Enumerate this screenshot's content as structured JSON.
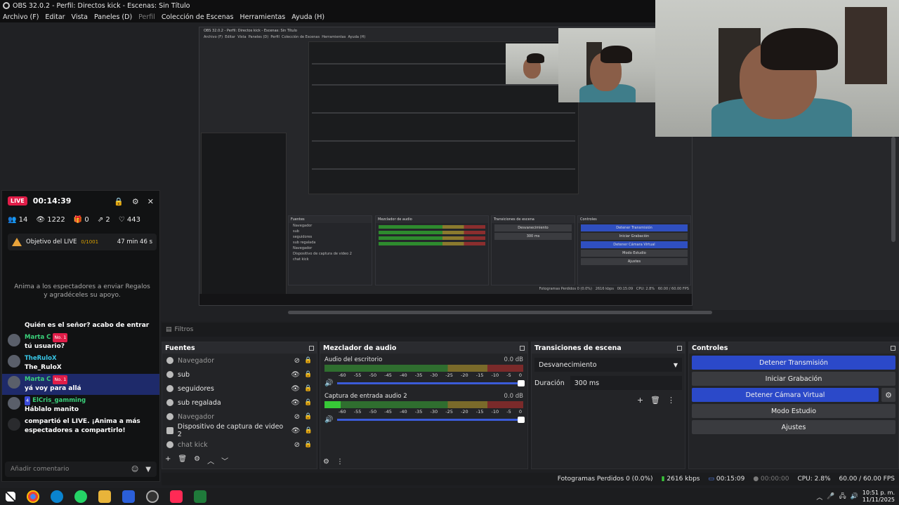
{
  "window": {
    "title": "OBS 32.0.2 - Perfil: Directos kick - Escenas: Sin Título"
  },
  "menu": [
    {
      "label": "Archivo (F)",
      "enabled": true
    },
    {
      "label": "Editar",
      "enabled": true
    },
    {
      "label": "Vista",
      "enabled": true
    },
    {
      "label": "Paneles (D)",
      "enabled": true
    },
    {
      "label": "Perfil",
      "enabled": false
    },
    {
      "label": "Colección de Escenas",
      "enabled": true
    },
    {
      "label": "Herramientas",
      "enabled": true
    },
    {
      "label": "Ayuda (H)",
      "enabled": true
    }
  ],
  "live_widget": {
    "badge": "LIVE",
    "timer": "00:14:39",
    "stats": {
      "viewers": "14",
      "views": "1222",
      "gifts": "0",
      "shares": "2",
      "likes": "443"
    },
    "goal": {
      "title": "Objetivo del LIVE",
      "count": "0/1001",
      "time_left": "47 min 46 s"
    },
    "prompt": "Anima a los espectadores a enviar Regalos y agradéceles su apoyo.",
    "comments": [
      {
        "name": "",
        "text": "Quién es el señor? acabo de entrar",
        "tag": "",
        "highlight": false
      },
      {
        "name": "Marta C",
        "tag": "No. 1",
        "text": "tú usuario?",
        "highlight": false
      },
      {
        "name": "TheRuloX",
        "tag": "",
        "text": "The_RuloX",
        "highlight": false
      },
      {
        "name": "Marta C",
        "tag": "No. 1",
        "text": "yá voy para allá",
        "highlight": true
      },
      {
        "name": "ElCris_gamming",
        "tag": "4",
        "text": "Háblalo manito",
        "highlight": false
      },
      {
        "name": "",
        "tag": "",
        "text": "compartió el LIVE. ¡Anima a más espectadores a compartirlo!",
        "highlight": false
      }
    ],
    "comment_placeholder": "Añadir comentario"
  },
  "filters_label": "Filtros",
  "sources": {
    "title": "Fuentes",
    "items": [
      {
        "label": "Navegador",
        "visible": false
      },
      {
        "label": "sub",
        "visible": true
      },
      {
        "label": "seguidores",
        "visible": true
      },
      {
        "label": "sub regalada",
        "visible": true
      },
      {
        "label": "Navegador",
        "visible": false
      },
      {
        "label": "Dispositivo de captura de video 2",
        "visible": true
      },
      {
        "label": "chat kick",
        "visible": false
      }
    ]
  },
  "mixer": {
    "title": "Mezclador de audio",
    "channels": [
      {
        "name": "Audio del escritorio",
        "db": "0.0 dB",
        "level": 0
      },
      {
        "name": "Captura de entrada audio 2",
        "db": "0.0 dB",
        "level": 0.08
      }
    ],
    "ticks": [
      "-60",
      "-55",
      "-50",
      "-45",
      "-40",
      "-35",
      "-30",
      "-25",
      "-20",
      "-15",
      "-10",
      "-5",
      "0"
    ]
  },
  "transitions": {
    "title": "Transiciones de escena",
    "selected": "Desvanecimiento",
    "duration_label": "Duración",
    "duration_value": "300 ms"
  },
  "controls": {
    "title": "Controles",
    "stop_stream": "Detener Transmisión",
    "start_recording": "Iniciar Grabación",
    "stop_virtual_cam": "Detener Cámara Virtual",
    "studio_mode": "Modo Estudio",
    "settings": "Ajustes"
  },
  "status": {
    "dropped_frames": "Fotogramas Perdidos 0 (0.0%)",
    "bitrate": "2616 kbps",
    "stream_time": "00:15:09",
    "rec_time": "00:00:00",
    "cpu": "CPU: 2.8%",
    "fps": "60.00 / 60.00 FPS"
  },
  "taskbar": {
    "time": "10:51 p. m.",
    "date": "11/11/2025"
  },
  "colors": {
    "accent_blue": "#2b49c9",
    "live_red": "#e11d48",
    "ok_green": "#3ac83a"
  }
}
